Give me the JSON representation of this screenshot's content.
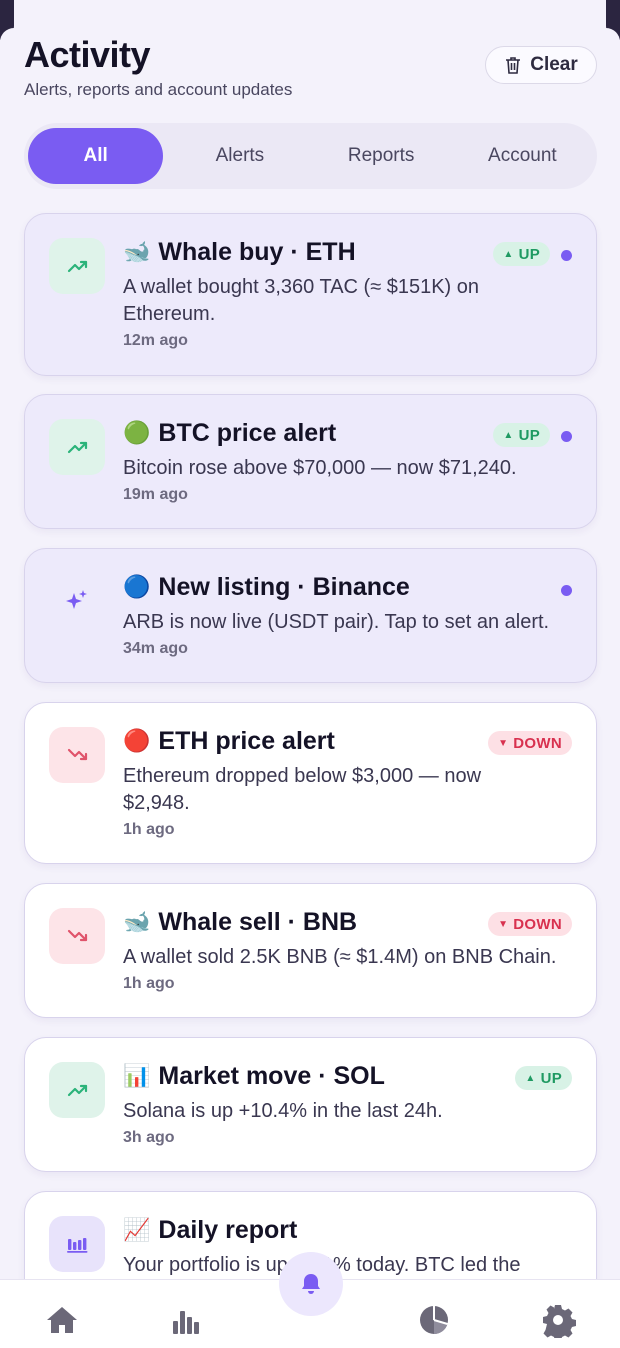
{
  "header": {
    "title": "Activity",
    "subtitle": "Alerts, reports and account updates",
    "clear_label": "Clear"
  },
  "tabs": [
    {
      "label": "All",
      "active": true
    },
    {
      "label": "Alerts",
      "active": false
    },
    {
      "label": "Reports",
      "active": false
    },
    {
      "label": "Account",
      "active": false
    }
  ],
  "notifications": [
    {
      "emoji": "🐋",
      "title": "Whale buy · ETH",
      "body": "A wallet bought 3,360 TAC (≈ $151K) on Ethereum.",
      "time": "12m ago",
      "badge": "UP",
      "unread": true,
      "icon": "trending-up-icon"
    },
    {
      "emoji": "🟢",
      "title": "BTC price alert",
      "body": "Bitcoin rose above $70,000 — now $71,240.",
      "time": "19m ago",
      "badge": "UP",
      "unread": true,
      "icon": "trending-up-icon"
    },
    {
      "emoji": "🔵",
      "title": "New listing · Binance",
      "body": "ARB is now live (USDT pair). Tap to set an alert.",
      "time": "34m ago",
      "badge": "",
      "unread": true,
      "icon": "sparkles-icon"
    },
    {
      "emoji": "🔴",
      "title": "ETH price alert",
      "body": "Ethereum dropped below $3,000 — now $2,948.",
      "time": "1h ago",
      "badge": "DOWN",
      "unread": false,
      "icon": "trending-down-icon"
    },
    {
      "emoji": "🐋",
      "title": "Whale sell · BNB",
      "body": "A wallet sold 2.5K BNB (≈ $1.4M) on BNB Chain.",
      "time": "1h ago",
      "badge": "DOWN",
      "unread": false,
      "icon": "trending-down-icon"
    },
    {
      "emoji": "📊",
      "title": "Market move · SOL",
      "body": "Solana is up +10.4% in the last 24h.",
      "time": "3h ago",
      "badge": "UP",
      "unread": false,
      "icon": "trending-up-icon"
    },
    {
      "emoji": "📈",
      "title": "Daily report",
      "body": "Your portfolio is up +2.1% today. BTC led the",
      "time": "",
      "badge": "",
      "unread": false,
      "icon": "bar-chart-icon"
    }
  ],
  "colors": {
    "accent": "#7a5cf2",
    "up": "#1f9a62",
    "down": "#d8314f"
  },
  "bottom_nav": [
    "home-icon",
    "bar-chart-icon",
    "bell-icon",
    "pie-chart-icon",
    "settings-gear-icon"
  ]
}
